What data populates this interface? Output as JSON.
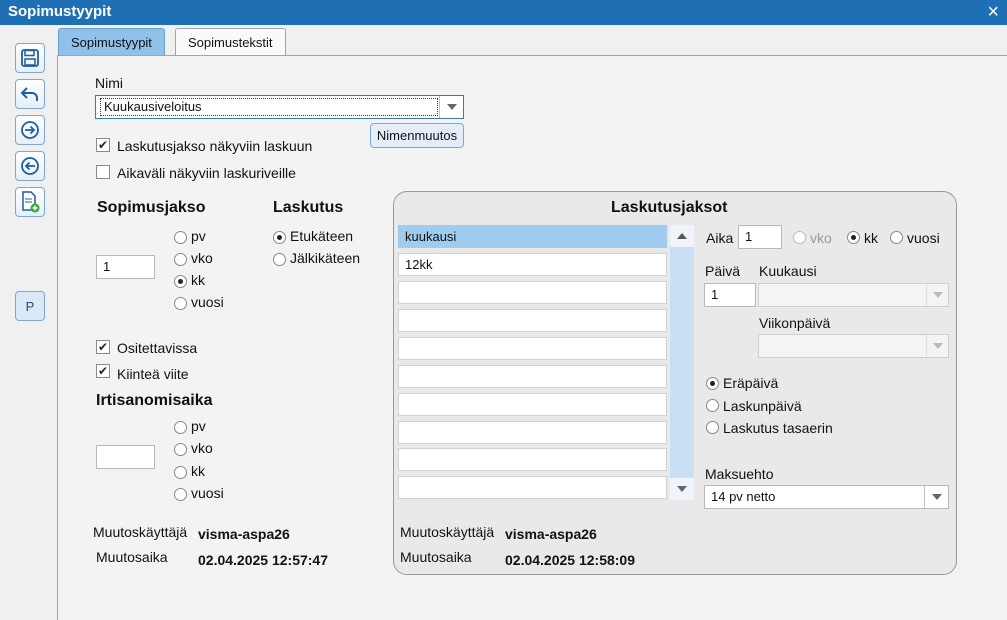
{
  "window": {
    "title": "Sopimustyypit",
    "close_icon": "×"
  },
  "toolbar": {
    "buttons": [
      "save-icon",
      "undo-icon",
      "next-icon",
      "previous-icon",
      "new-document-icon"
    ],
    "p_button_label": "P"
  },
  "tabs": [
    {
      "label": "Sopimustyypit",
      "active": true
    },
    {
      "label": "Sopimustekstit",
      "active": false
    }
  ],
  "form": {
    "nimi_label": "Nimi",
    "nimi_value": "Kuukausiveloitus",
    "rename_button": "Nimenmuutos",
    "checkbox_laskutusjakso": {
      "label": "Laskutusjakso näkyviin laskuun",
      "checked": true
    },
    "checkbox_aikavali": {
      "label": "Aikaväli näkyviin laskuriveille",
      "checked": false
    },
    "sopimusjakso": {
      "heading": "Sopimusjakso",
      "value": "1",
      "options": [
        "pv",
        "vko",
        "kk",
        "vuosi"
      ],
      "selected": "kk"
    },
    "laskutus": {
      "heading": "Laskutus",
      "options": [
        "Etukäteen",
        "Jälkikäteen"
      ],
      "selected": "Etukäteen"
    },
    "checkbox_ositettavissa": {
      "label": "Ositettavissa",
      "checked": true
    },
    "checkbox_kiintea_viite": {
      "label": "Kiinteä viite",
      "checked": true
    },
    "irtisanomisaika": {
      "heading": "Irtisanomisaika",
      "value": "",
      "options": [
        "pv",
        "vko",
        "kk",
        "vuosi"
      ],
      "selected": null
    },
    "muutoskayttaja_label": "Muutoskäyttäjä",
    "muutoskayttaja_value": "visma-aspa26",
    "muutosaika_label": "Muutosaika",
    "muutosaika_value": "02.04.2025 12:57:47"
  },
  "laskutusjaksot": {
    "heading": "Laskutusjaksot",
    "items": [
      "kuukausi",
      "12kk",
      "",
      "",
      "",
      "",
      "",
      "",
      "",
      ""
    ],
    "selected_index": 0,
    "aika_label": "Aika",
    "aika_value": "1",
    "aika_options": [
      "vko",
      "kk",
      "vuosi"
    ],
    "aika_selected": "kk",
    "paiva_label": "Päivä",
    "paiva_value": "1",
    "kuukausi_label": "Kuukausi",
    "kuukausi_value": "",
    "viikonpaiva_label": "Viikonpäivä",
    "viikonpaiva_value": "",
    "date_options": [
      "Eräpäivä",
      "Laskunpäivä",
      "Laskutus tasaerin"
    ],
    "date_selected": "Eräpäivä",
    "maksuehto_label": "Maksuehto",
    "maksuehto_value": "14 pv netto",
    "muutoskayttaja_label": "Muutoskäyttäjä",
    "muutoskayttaja_value": "visma-aspa26",
    "muutosaika_label": "Muutosaika",
    "muutosaika_value": "02.04.2025 12:58:09"
  }
}
